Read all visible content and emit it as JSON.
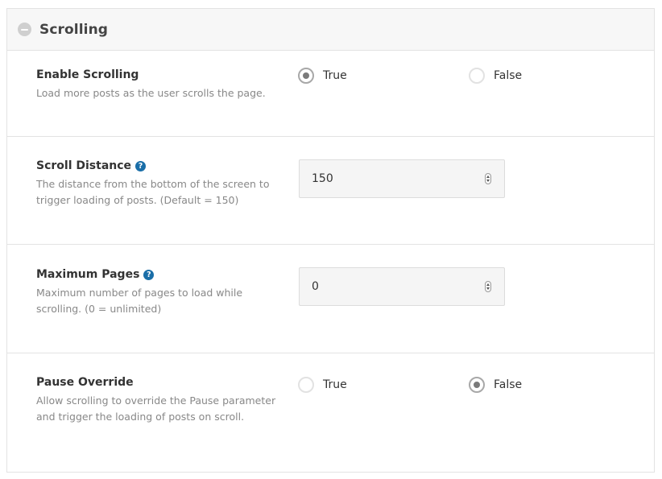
{
  "section": {
    "title": "Scrolling",
    "collapse_icon": "minus-circle-icon"
  },
  "settings": [
    {
      "title": "Enable Scrolling",
      "description": "Load more posts as the user scrolls the page.",
      "type": "radio",
      "options": [
        "True",
        "False"
      ],
      "selected": "True"
    },
    {
      "title": "Scroll Distance",
      "description": "The distance from the bottom of the screen to trigger loading of posts. (Default = 150)",
      "type": "number",
      "value": "150",
      "help_icon": "question-circle-icon"
    },
    {
      "title": "Maximum Pages",
      "description": "Maximum number of pages to load while scrolling. (0 = unlimited)",
      "type": "number",
      "value": "0",
      "help_icon": "question-circle-icon"
    },
    {
      "title": "Pause Override",
      "description": "Allow scrolling to override the Pause parameter and trigger the loading of posts on scroll.",
      "type": "radio",
      "options": [
        "True",
        "False"
      ],
      "selected": "False"
    }
  ],
  "colors": {
    "help_icon": "#1a6ea8",
    "header_bg": "#f7f7f7",
    "border": "#e3e3e3"
  }
}
